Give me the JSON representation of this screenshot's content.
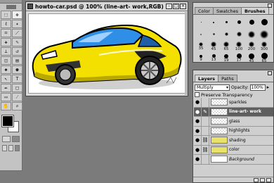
{
  "document": {
    "title": "howto-car.psd @ 100% (line-art- work,RGB)",
    "window_buttons": [
      "–",
      "□",
      "×"
    ]
  },
  "tools": {
    "items": [
      {
        "name": "marquee",
        "glyph": "⬚"
      },
      {
        "name": "move",
        "glyph": "✥"
      },
      {
        "name": "lasso",
        "glyph": "ℓ"
      },
      {
        "name": "magic-wand",
        "glyph": "✦"
      },
      {
        "name": "crop",
        "glyph": "⌗"
      },
      {
        "name": "slice",
        "glyph": "⟋"
      },
      {
        "name": "healing",
        "glyph": "✚"
      },
      {
        "name": "brush",
        "glyph": "✎"
      },
      {
        "name": "stamp",
        "glyph": "⊥"
      },
      {
        "name": "history-brush",
        "glyph": "↺"
      },
      {
        "name": "eraser",
        "glyph": "◫"
      },
      {
        "name": "gradient",
        "glyph": "▤"
      },
      {
        "name": "blur",
        "glyph": "◆"
      },
      {
        "name": "dodge",
        "glyph": "●"
      },
      {
        "name": "path-select",
        "glyph": "↖"
      },
      {
        "name": "type",
        "glyph": "T"
      },
      {
        "name": "pen",
        "glyph": "✒"
      },
      {
        "name": "shape",
        "glyph": "□"
      },
      {
        "name": "notes",
        "glyph": "▭"
      },
      {
        "name": "eyedropper",
        "glyph": "⁄"
      },
      {
        "name": "hand",
        "glyph": "✋"
      },
      {
        "name": "zoom",
        "glyph": "⌕"
      }
    ]
  },
  "brushes_palette": {
    "tabs": [
      "Color",
      "Swatches",
      "Brushes"
    ],
    "active_tab": "Brushes",
    "labels": [
      "35",
      "45",
      "65",
      "100",
      "200",
      "300",
      "9",
      "13",
      "19",
      "17",
      "45",
      "65",
      "100",
      "200",
      "300"
    ]
  },
  "layers_palette": {
    "tabs": [
      "Layers",
      "Paths"
    ],
    "blend_mode": "Multiply",
    "opacity_label": "Opacity:",
    "opacity_value": "100%",
    "preserve_label": "Preserve Transparency",
    "layers": [
      {
        "name": "sparkles"
      },
      {
        "name": "line-art- work"
      },
      {
        "name": "glass"
      },
      {
        "name": "highlights"
      },
      {
        "name": "shading"
      },
      {
        "name": "color"
      },
      {
        "name": "Background"
      }
    ]
  },
  "colors": {
    "car_yellow": "#f3e000",
    "glass_blue": "#2f8fe6",
    "layer_selected": "#5e5e5e"
  }
}
